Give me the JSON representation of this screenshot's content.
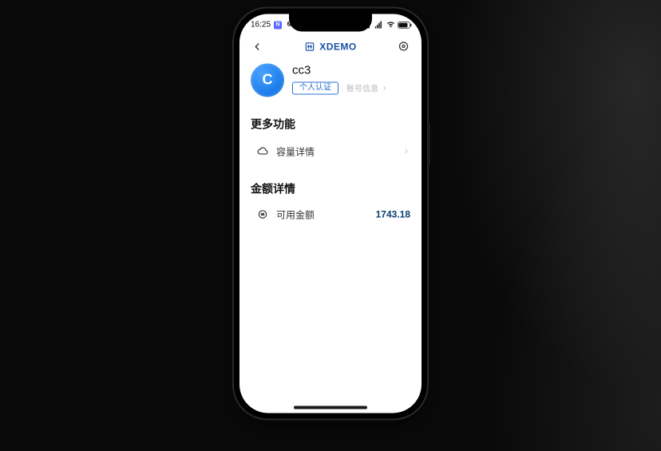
{
  "status": {
    "time": "16:25",
    "app_badge": "N"
  },
  "header": {
    "brand": "XDEMO"
  },
  "profile": {
    "avatar_letter": "C",
    "username": "cc3",
    "chip_personal": "个人认证",
    "account_info": "账号信息"
  },
  "sections": {
    "more_title": "更多功能",
    "capacity_label": "容量详情",
    "amount_title": "金额详情",
    "available_label": "可用金额",
    "available_value": "1743.18"
  }
}
